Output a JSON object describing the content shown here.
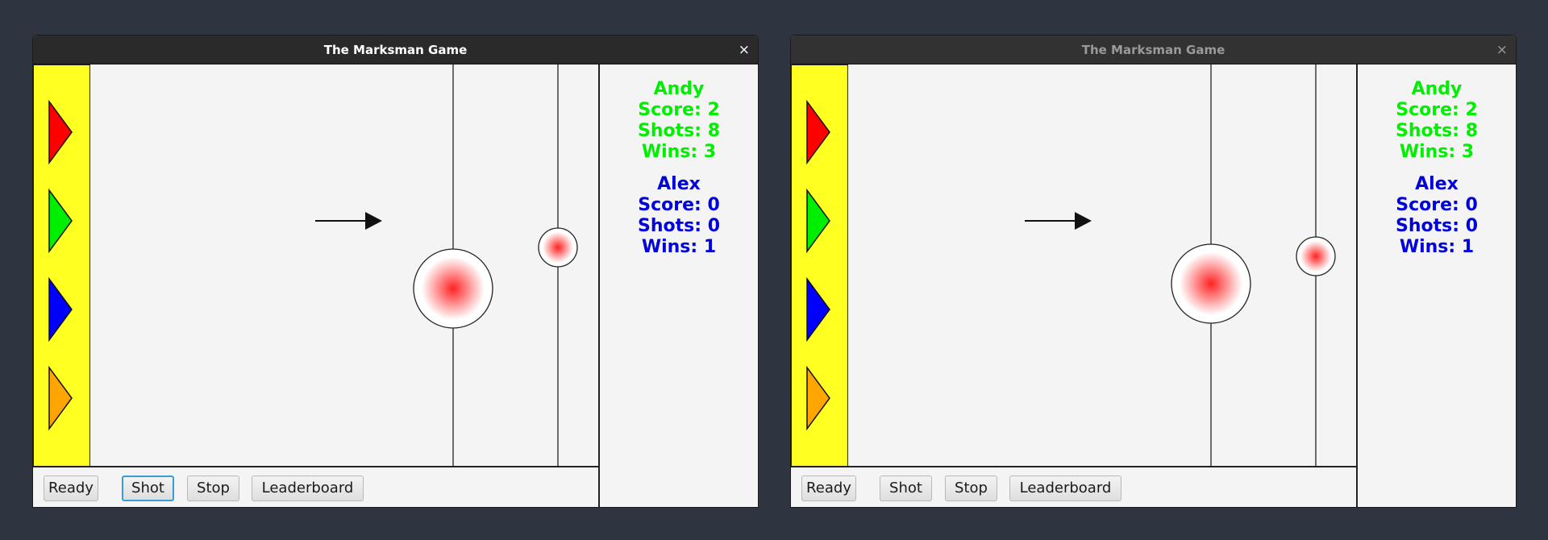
{
  "colors": {
    "panel_yellow": "#ffff22",
    "player1": "#00ee00",
    "player2": "#0000dd",
    "target_center": "#ff2222",
    "focus_ring": "#3d9ad9"
  },
  "windows": [
    {
      "title": "The Marksman Game",
      "close_label": "×",
      "state": "focused",
      "launchers": [
        {
          "color": "#ff0000",
          "icon": "red-triangle-icon"
        },
        {
          "color": "#00ee00",
          "icon": "green-triangle-icon"
        },
        {
          "color": "#0000ff",
          "icon": "blue-triangle-icon"
        },
        {
          "color": "#ffa500",
          "icon": "orange-triangle-icon"
        }
      ],
      "buttons": {
        "ready": "Ready",
        "shot": "Shot",
        "stop": "Stop",
        "leaderboard": "Leaderboard"
      },
      "focused_button": "shot",
      "players": [
        {
          "name": "Andy",
          "score": "Score: 2",
          "shots": "Shots: 8",
          "wins": "Wins: 3"
        },
        {
          "name": "Alex",
          "score": "Score: 0",
          "shots": "Shots: 0",
          "wins": "Wins: 1"
        }
      ]
    },
    {
      "title": "The Marksman Game",
      "close_label": "×",
      "state": "inactive",
      "launchers": [
        {
          "color": "#ff0000",
          "icon": "red-triangle-icon"
        },
        {
          "color": "#00ee00",
          "icon": "green-triangle-icon"
        },
        {
          "color": "#0000ff",
          "icon": "blue-triangle-icon"
        },
        {
          "color": "#ffa500",
          "icon": "orange-triangle-icon"
        }
      ],
      "buttons": {
        "ready": "Ready",
        "shot": "Shot",
        "stop": "Stop",
        "leaderboard": "Leaderboard"
      },
      "focused_button": "",
      "players": [
        {
          "name": "Andy",
          "score": "Score: 2",
          "shots": "Shots: 8",
          "wins": "Wins: 3"
        },
        {
          "name": "Alex",
          "score": "Score: 0",
          "shots": "Shots: 0",
          "wins": "Wins: 1"
        }
      ]
    }
  ]
}
